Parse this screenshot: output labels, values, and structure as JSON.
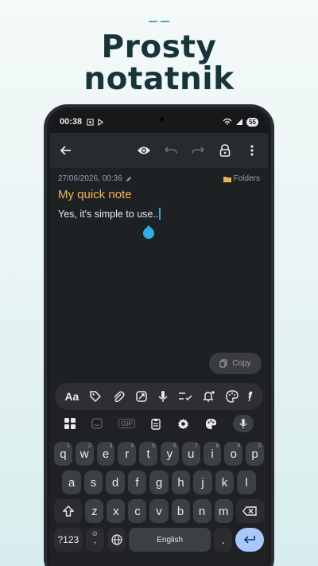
{
  "headline": {
    "line1": "Prosty",
    "line2": "notatnik"
  },
  "statusbar": {
    "time": "00:38",
    "battery": "55"
  },
  "toolbar": {
    "back": "back-arrow-icon",
    "actions": [
      "eye-icon",
      "undo-icon",
      "redo-icon",
      "lock-icon",
      "more-vert-icon"
    ]
  },
  "note": {
    "date": "27/06/2026, 00:36",
    "folders_label": "Folders",
    "title": "My quick note",
    "body": "Yes, it's simple to use.."
  },
  "copy_button": {
    "label": "Copy"
  },
  "keyboard": {
    "suggestion_icons": [
      "text-format-icon",
      "tag-icon",
      "attach-icon",
      "resize-icon",
      "mic-icon",
      "checklist-icon",
      "add-reminder-icon",
      "palette-icon",
      "more-icon"
    ],
    "tool_icons": [
      "apps-grid-icon",
      "sticker-icon",
      "gif-icon",
      "clipboard-icon",
      "settings-icon",
      "theme-palette-icon",
      "voice-icon"
    ],
    "gif_label": "GIF",
    "row1": [
      {
        "k": "q",
        "n": "1"
      },
      {
        "k": "w",
        "n": "2"
      },
      {
        "k": "e",
        "n": "3"
      },
      {
        "k": "r",
        "n": "4"
      },
      {
        "k": "t",
        "n": "5"
      },
      {
        "k": "y",
        "n": "6"
      },
      {
        "k": "u",
        "n": "7"
      },
      {
        "k": "i",
        "n": "8"
      },
      {
        "k": "o",
        "n": "9"
      },
      {
        "k": "p",
        "n": "0"
      }
    ],
    "row2": [
      "a",
      "s",
      "d",
      "f",
      "g",
      "h",
      "j",
      "k",
      "l"
    ],
    "row3": [
      "z",
      "x",
      "c",
      "v",
      "b",
      "n",
      "m"
    ],
    "symbols_label": "?123",
    "emoji_label": "☺",
    "comma_label": ",",
    "space_label": "English",
    "period_label": "."
  },
  "colors": {
    "accent_title": "#f2b64c",
    "cursor": "#2fb0e3",
    "enter_key": "#a8c7fa",
    "headline": "#17343a"
  }
}
